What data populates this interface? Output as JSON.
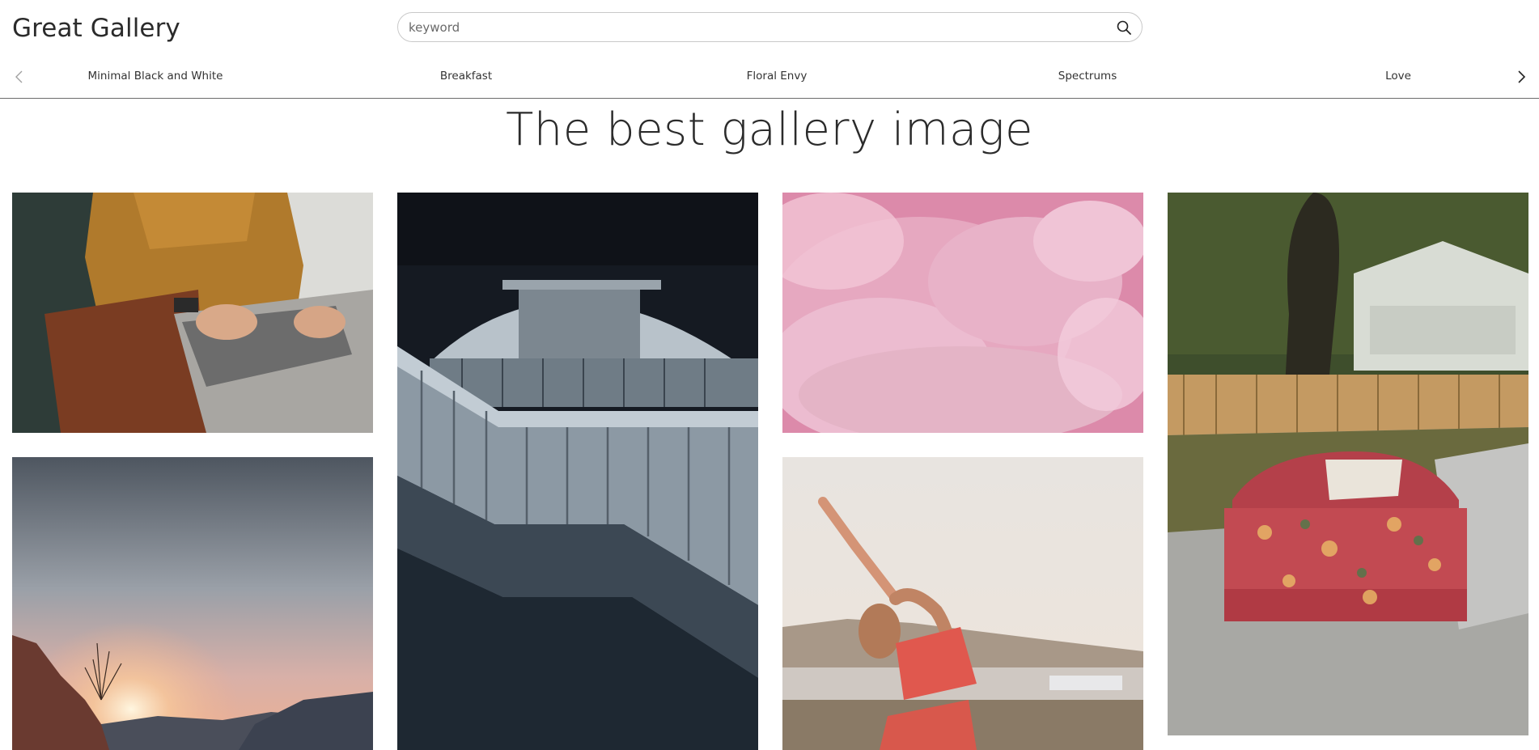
{
  "app": {
    "title": "Great Gallery"
  },
  "search": {
    "placeholder": "keyword"
  },
  "categories": [
    {
      "label": "Minimal Black and White"
    },
    {
      "label": "Breakfast"
    },
    {
      "label": "Floral Envy"
    },
    {
      "label": "Spectrums"
    },
    {
      "label": "Love"
    }
  ],
  "main": {
    "heading": "The best gallery image"
  },
  "icons": {
    "search": "search-icon",
    "prev": "chevron-left-icon",
    "next": "chevron-right-icon"
  },
  "colors": {
    "text": "#2b2b2b",
    "divider": "#6b6b6b",
    "search_border": "#c9c9c9"
  }
}
